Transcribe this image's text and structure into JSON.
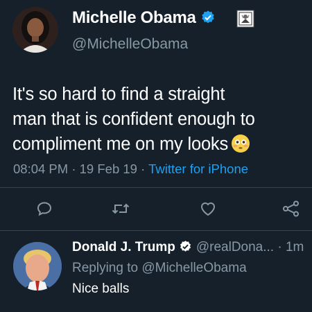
{
  "tweet": {
    "author_name": "Michelle Obama",
    "author_handle": "@MichelleObama",
    "text_lines": [
      "It's so hard to find a straight",
      "man that is confident enough to",
      "compliment me on my looks"
    ],
    "emoji": "flushed-face",
    "time": "08:04 PM",
    "date": "19 Feb 19",
    "client": "Twitter for iPhone"
  },
  "actions": [
    "reply-icon",
    "retweet-icon",
    "like-icon",
    "share-icon"
  ],
  "reply": {
    "author_name": "Donald J. Trump",
    "author_handle": "@realDona...",
    "time_ago": "1m",
    "replying_label": "Replying to",
    "replying_to": "@MichelleObama",
    "text": "Nice balls"
  },
  "colors": {
    "background": "#15202b",
    "text": "#ffffff",
    "muted": "#8899a6",
    "accent": "#1da1f2",
    "divider": "#38444d"
  }
}
